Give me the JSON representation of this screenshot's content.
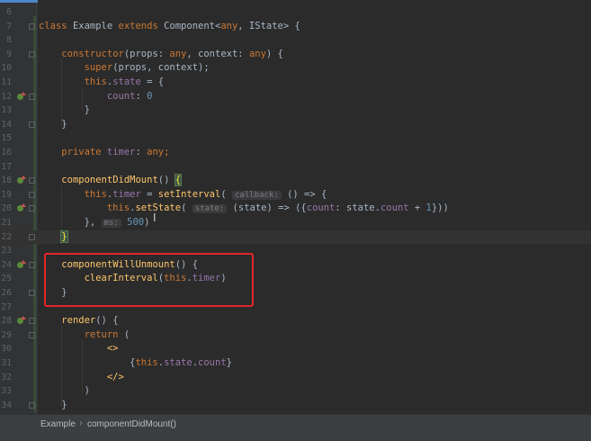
{
  "editor": {
    "lines": [
      {
        "num": "6",
        "tokens": []
      },
      {
        "num": "7",
        "tokens": [
          {
            "t": "class ",
            "c": "kw"
          },
          {
            "t": "Example ",
            "c": "pl"
          },
          {
            "t": "extends ",
            "c": "kw"
          },
          {
            "t": "Component<",
            "c": "pl"
          },
          {
            "t": "any",
            "c": "kw"
          },
          {
            "t": ", IState> {",
            "c": "pl"
          }
        ]
      },
      {
        "num": "8",
        "tokens": []
      },
      {
        "num": "9",
        "tokens": [
          {
            "t": "    ",
            "c": "pl"
          },
          {
            "t": "constructor",
            "c": "kw"
          },
          {
            "t": "(props: ",
            "c": "pl"
          },
          {
            "t": "any",
            "c": "kw"
          },
          {
            "t": ", context: ",
            "c": "pl"
          },
          {
            "t": "any",
            "c": "kw"
          },
          {
            "t": ") {",
            "c": "pl"
          }
        ]
      },
      {
        "num": "10",
        "tokens": [
          {
            "t": "        ",
            "c": "pl"
          },
          {
            "t": "super",
            "c": "kw"
          },
          {
            "t": "(props, context);",
            "c": "pl"
          }
        ]
      },
      {
        "num": "11",
        "tokens": [
          {
            "t": "        ",
            "c": "pl"
          },
          {
            "t": "this",
            "c": "kw"
          },
          {
            "t": ".",
            "c": "pl"
          },
          {
            "t": "state",
            "c": "prop"
          },
          {
            "t": " = {",
            "c": "pl"
          }
        ]
      },
      {
        "num": "12",
        "tokens": [
          {
            "t": "            ",
            "c": "pl"
          },
          {
            "t": "count",
            "c": "prop"
          },
          {
            "t": ": ",
            "c": "pl"
          },
          {
            "t": "0",
            "c": "num"
          }
        ]
      },
      {
        "num": "13",
        "tokens": [
          {
            "t": "        }",
            "c": "pl"
          }
        ]
      },
      {
        "num": "14",
        "tokens": [
          {
            "t": "    }",
            "c": "pl"
          }
        ]
      },
      {
        "num": "15",
        "tokens": []
      },
      {
        "num": "16",
        "tokens": [
          {
            "t": "    ",
            "c": "pl"
          },
          {
            "t": "private ",
            "c": "kw"
          },
          {
            "t": "timer",
            "c": "prop"
          },
          {
            "t": ": ",
            "c": "pl"
          },
          {
            "t": "any",
            "c": "kw"
          },
          {
            "t": ";",
            "c": "kw"
          }
        ]
      },
      {
        "num": "17",
        "tokens": []
      },
      {
        "num": "18",
        "tokens": [
          {
            "t": "    ",
            "c": "pl"
          },
          {
            "t": "componentDidMount",
            "c": "fn"
          },
          {
            "t": "() ",
            "c": "pl"
          },
          {
            "t": "{",
            "c": "brace-hl"
          }
        ]
      },
      {
        "num": "19",
        "tokens": [
          {
            "t": "        ",
            "c": "pl"
          },
          {
            "t": "this",
            "c": "kw"
          },
          {
            "t": ".",
            "c": "pl"
          },
          {
            "t": "timer",
            "c": "prop"
          },
          {
            "t": " = ",
            "c": "pl"
          },
          {
            "t": "setInterval",
            "c": "fn"
          },
          {
            "t": "( ",
            "c": "pl"
          },
          {
            "t": "callback:",
            "c": "hint"
          },
          {
            "t": " () => {",
            "c": "pl"
          }
        ]
      },
      {
        "num": "20",
        "tokens": [
          {
            "t": "            ",
            "c": "pl"
          },
          {
            "t": "this",
            "c": "kw"
          },
          {
            "t": ".",
            "c": "pl"
          },
          {
            "t": "setState",
            "c": "fn"
          },
          {
            "t": "( ",
            "c": "pl"
          },
          {
            "t": "state:",
            "c": "hint"
          },
          {
            "t": " (state) => ({",
            "c": "pl"
          },
          {
            "t": "count",
            "c": "prop"
          },
          {
            "t": ": state.",
            "c": "pl"
          },
          {
            "t": "count",
            "c": "prop"
          },
          {
            "t": " + ",
            "c": "pl"
          },
          {
            "t": "1",
            "c": "num"
          },
          {
            "t": "}))",
            "c": "pl"
          }
        ]
      },
      {
        "num": "21",
        "tokens": [
          {
            "t": "        }, ",
            "c": "pl"
          },
          {
            "t": "ms:",
            "c": "hint"
          },
          {
            "t": " ",
            "c": "pl"
          },
          {
            "t": "500",
            "c": "num"
          },
          {
            "t": ")",
            "c": "pl"
          }
        ]
      },
      {
        "num": "22",
        "current": true,
        "tokens": [
          {
            "t": "    ",
            "c": "pl"
          },
          {
            "t": "}",
            "c": "brace-hl"
          }
        ]
      },
      {
        "num": "23",
        "tokens": []
      },
      {
        "num": "24",
        "tokens": [
          {
            "t": "    ",
            "c": "pl"
          },
          {
            "t": "componentWillUnmount",
            "c": "fn"
          },
          {
            "t": "() {",
            "c": "pl"
          }
        ]
      },
      {
        "num": "25",
        "tokens": [
          {
            "t": "        ",
            "c": "pl"
          },
          {
            "t": "clearInterval",
            "c": "fn"
          },
          {
            "t": "(",
            "c": "pl"
          },
          {
            "t": "this",
            "c": "kw"
          },
          {
            "t": ".",
            "c": "pl"
          },
          {
            "t": "timer",
            "c": "prop"
          },
          {
            "t": ")",
            "c": "pl"
          }
        ]
      },
      {
        "num": "26",
        "tokens": [
          {
            "t": "    }",
            "c": "pl"
          }
        ]
      },
      {
        "num": "27",
        "tokens": []
      },
      {
        "num": "28",
        "tokens": [
          {
            "t": "    ",
            "c": "pl"
          },
          {
            "t": "render",
            "c": "fn"
          },
          {
            "t": "() {",
            "c": "pl"
          }
        ]
      },
      {
        "num": "29",
        "tokens": [
          {
            "t": "        ",
            "c": "pl"
          },
          {
            "t": "return",
            "c": "kw"
          },
          {
            "t": " (",
            "c": "pl"
          }
        ]
      },
      {
        "num": "30",
        "tokens": [
          {
            "t": "            ",
            "c": "pl"
          },
          {
            "t": "<>",
            "c": "fn"
          }
        ]
      },
      {
        "num": "31",
        "tokens": [
          {
            "t": "                {",
            "c": "pl"
          },
          {
            "t": "this",
            "c": "kw"
          },
          {
            "t": ".",
            "c": "pl"
          },
          {
            "t": "state",
            "c": "prop"
          },
          {
            "t": ".",
            "c": "pl"
          },
          {
            "t": "count",
            "c": "prop"
          },
          {
            "t": "}",
            "c": "pl"
          }
        ]
      },
      {
        "num": "32",
        "tokens": [
          {
            "t": "            ",
            "c": "pl"
          },
          {
            "t": "</>",
            "c": "fn"
          }
        ]
      },
      {
        "num": "33",
        "tokens": [
          {
            "t": "        )",
            "c": "pl"
          }
        ]
      },
      {
        "num": "34",
        "tokens": [
          {
            "t": "    }",
            "c": "pl"
          }
        ]
      }
    ],
    "fold_lines": [
      "7",
      "9",
      "12",
      "14",
      "18",
      "19",
      "20",
      "22",
      "24",
      "26",
      "28",
      "29",
      "34"
    ],
    "override_markers": [
      "12",
      "18",
      "20",
      "24",
      "28"
    ]
  },
  "breadcrumb": {
    "items": [
      "Example",
      "componentDidMount()"
    ],
    "separator": "›"
  },
  "colors": {
    "background": "#2b2b2b",
    "keyword": "#cc7832",
    "function": "#ffc66d",
    "property": "#9876aa",
    "number": "#6897bb",
    "highlight_box": "#e4252a"
  }
}
